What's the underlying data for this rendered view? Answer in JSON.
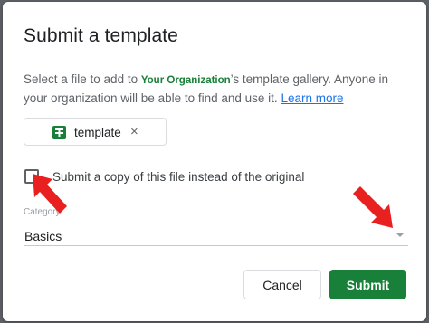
{
  "dialog": {
    "title": "Submit a template",
    "desc_before": "Select a file to add to ",
    "org_name": "Your Organization",
    "desc_after": "’s template gallery. Anyone in your organization will be able to find and use it. ",
    "learn_more": "Learn more",
    "file_chip": {
      "label": "template",
      "icon": "sheets-icon",
      "remove": "×"
    },
    "checkbox_label": "Submit a copy of this file instead of the original",
    "checkbox_checked": false,
    "category_label": "Category",
    "category_value": "Basics",
    "cancel_label": "Cancel",
    "submit_label": "Submit"
  },
  "colors": {
    "accent_green": "#188038",
    "link_blue": "#1a73e8",
    "annotation_red": "#e8201f"
  }
}
